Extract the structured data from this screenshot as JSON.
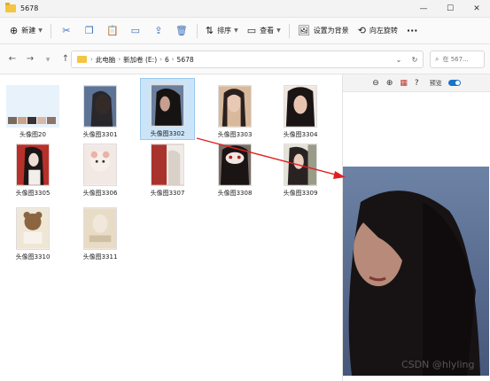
{
  "window": {
    "title": "5678",
    "minimize": "—",
    "maximize": "☐",
    "close": "✕"
  },
  "toolbar": {
    "new_label": "新建",
    "sort_label": "排序",
    "view_label": "查看",
    "set_bg_label": "设置为背景",
    "rotate_label": "向左旋转",
    "more_label": "···"
  },
  "address": {
    "crumbs": [
      "此电脑",
      "新加卷 (E:)",
      "6",
      "5678"
    ],
    "search_placeholder": "在 567..."
  },
  "files": [
    {
      "label": "头像图20",
      "selected": false
    },
    {
      "label": "头像图3301",
      "selected": false
    },
    {
      "label": "头像图3302",
      "selected": true
    },
    {
      "label": "头像图3303",
      "selected": false
    },
    {
      "label": "头像图3304",
      "selected": false
    },
    {
      "label": "头像图3305",
      "selected": false
    },
    {
      "label": "头像图3306",
      "selected": false
    },
    {
      "label": "头像图3307",
      "selected": false
    },
    {
      "label": "头像图3308",
      "selected": false
    },
    {
      "label": "头像图3309",
      "selected": false
    },
    {
      "label": "头像图3310",
      "selected": false
    },
    {
      "label": "头像图3311",
      "selected": false
    }
  ],
  "preview": {
    "toggle_label": "预览"
  },
  "watermark": "CSDN @hlyling",
  "colors": {
    "accent": "#1a73c8",
    "selection": "#cce4f7",
    "annotation_arrow": "#e02020"
  }
}
